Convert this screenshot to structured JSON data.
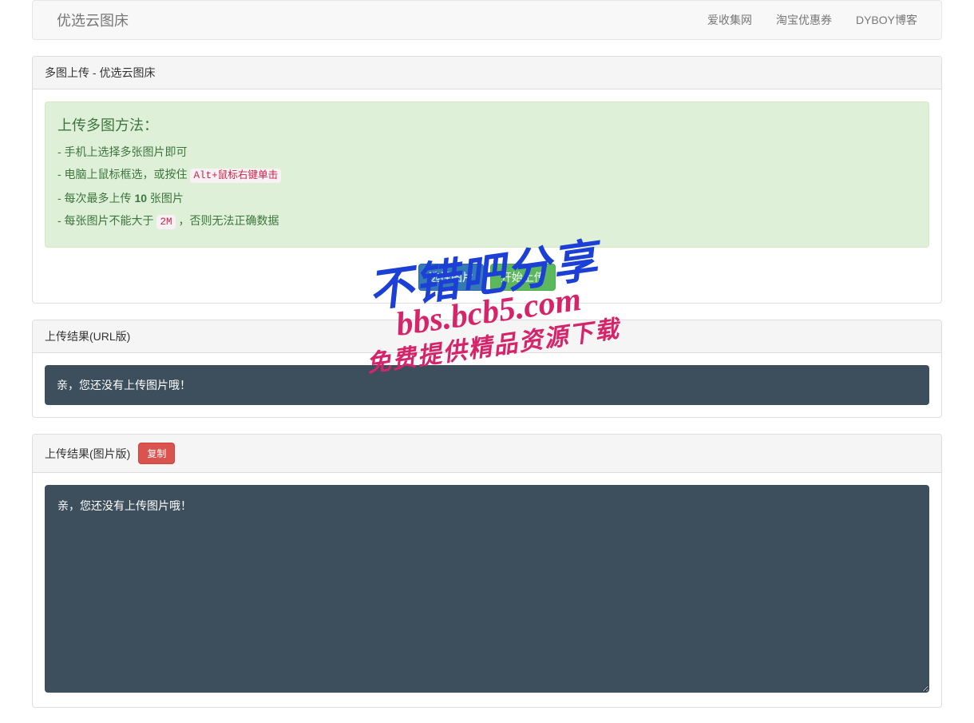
{
  "navbar": {
    "brand": "优选云图床",
    "links": [
      {
        "label": "爱收集网"
      },
      {
        "label": "淘宝优惠券"
      },
      {
        "label": "DYBOY博客"
      }
    ]
  },
  "upload_panel": {
    "heading": "多图上传 - 优选云图床",
    "alert_title": "上传多图方法：",
    "tip1": "- 手机上选择多张图片即可",
    "tip2_pre": "- 电脑上鼠标框选，或按住 ",
    "tip2_code": "Alt+鼠标右键单击",
    "tip3_pre": "- 每次最多上传 ",
    "tip3_bold": "10",
    "tip3_post": " 张图片",
    "tip4_pre": "- 每张图片不能大于 ",
    "tip4_code": "2M",
    "tip4_post": " ，否则无法正确数据",
    "select_btn": "选择图片",
    "upload_btn": "开始上传"
  },
  "result_url_panel": {
    "heading": "上传结果(URL版)",
    "empty_text": "亲，您还没有上传图片哦！"
  },
  "result_img_panel": {
    "heading": "上传结果(图片版)",
    "copy_btn": "复制",
    "empty_text": "亲，您还没有上传图片哦！"
  },
  "watermark": {
    "line1": "不错吧分享",
    "line2": "bbs.bcb5.com",
    "line3": "免费提供精品资源下载"
  }
}
